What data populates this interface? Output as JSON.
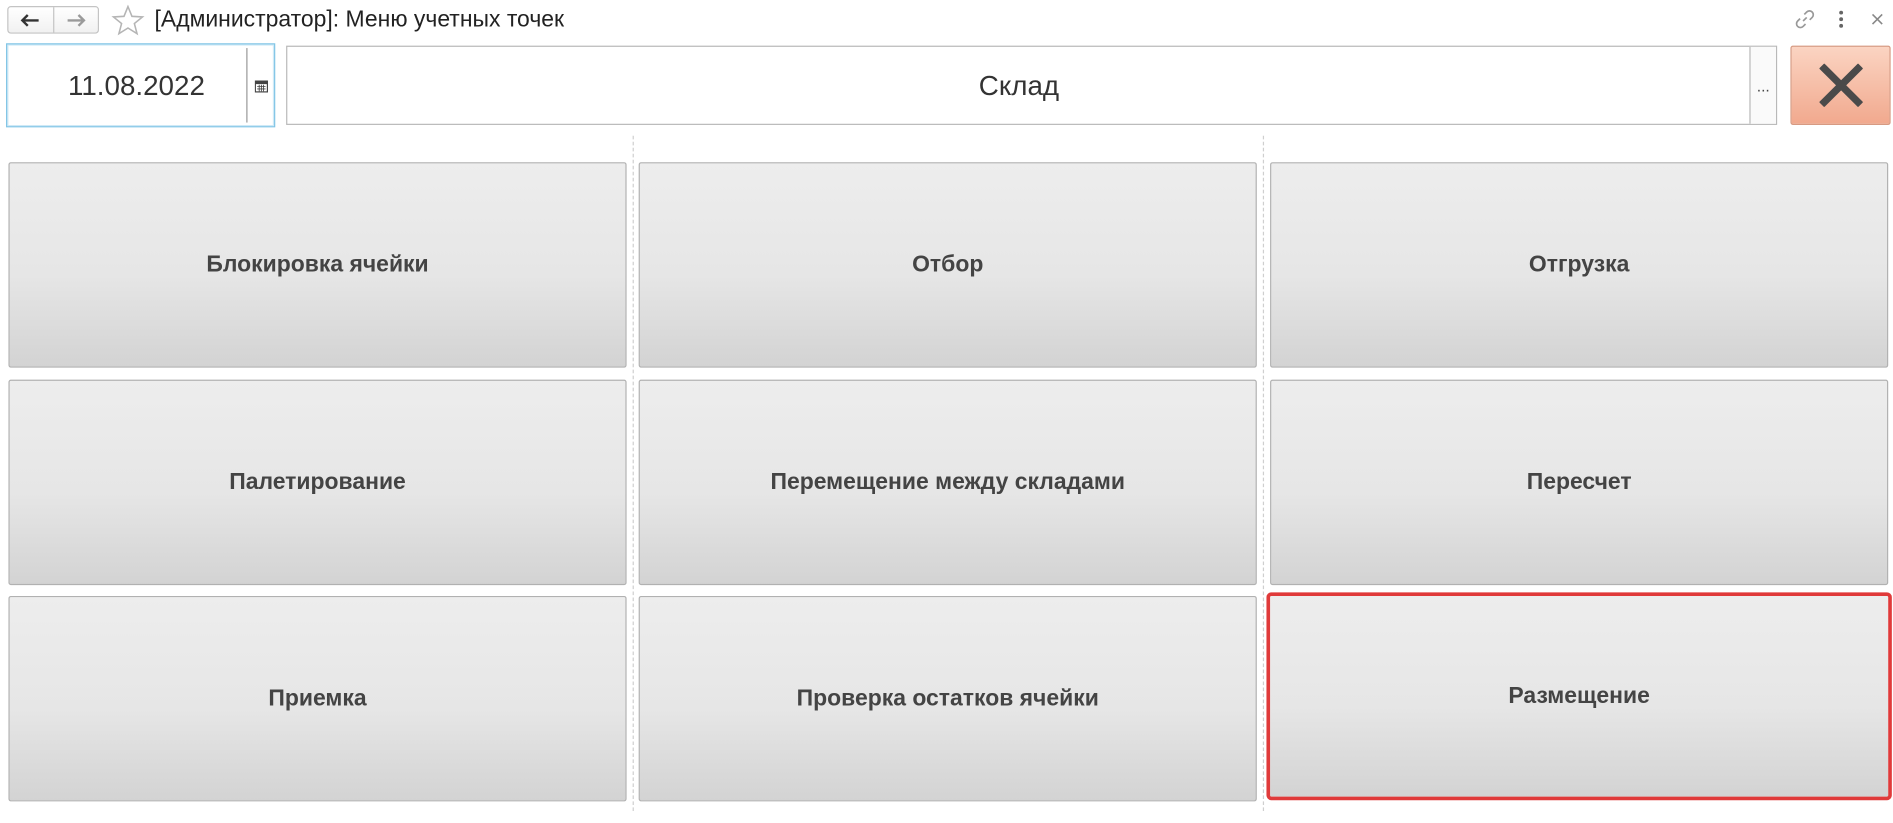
{
  "titlebar": {
    "title": "[Администратор]: Меню учетных точек",
    "icons": [
      "back-arrow-icon",
      "forward-arrow-icon",
      "star-icon",
      "link-icon",
      "more-icon",
      "close-icon"
    ]
  },
  "toolbar": {
    "date_value": "11.08.2022",
    "warehouse_value": "Склад",
    "choose_label": "...",
    "close_color": "#f4b49c"
  },
  "menu": {
    "items": [
      {
        "label": "Блокировка ячейки"
      },
      {
        "label": "Отбор"
      },
      {
        "label": "Отгрузка"
      },
      {
        "label": "Палетирование"
      },
      {
        "label": "Перемещение между складами"
      },
      {
        "label": "Пересчет"
      },
      {
        "label": "Приемка"
      },
      {
        "label": "Проверка остатков ячейки"
      },
      {
        "label": "Размещение"
      }
    ],
    "highlight_color": "#e03a3a"
  }
}
